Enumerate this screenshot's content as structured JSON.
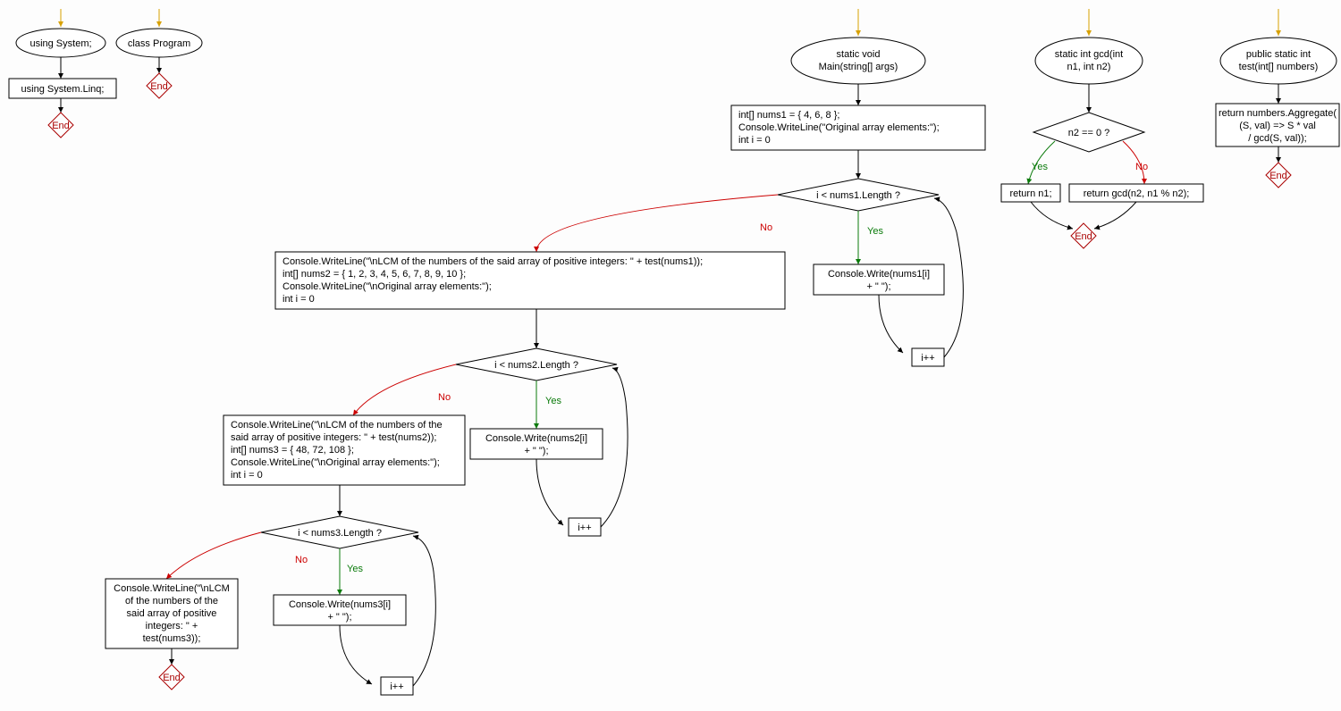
{
  "t_using_system": "using System;",
  "t_using_linq": "using System.Linq;",
  "t_class_program": "class Program",
  "t_end": "End",
  "t_main1": "static void",
  "t_main2": "Main(string[] args)",
  "t_main_block1_l1": "int[] nums1 = { 4, 6, 8 };",
  "t_main_block1_l2": "Console.WriteLine(\"Original array elements:\");",
  "t_main_block1_l3": "int i = 0",
  "t_cond1": "i < nums1.Length ?",
  "t_write1_l1": "Console.Write(nums1[i]",
  "t_write1_l2": "+ \" \");",
  "t_inc": "i++",
  "t_block2_l1": "Console.WriteLine(\"\\nLCM of the numbers of the said array of positive integers: \" + test(nums1));",
  "t_block2_l2": "int[] nums2 = { 1, 2, 3, 4, 5, 6, 7, 8, 9, 10 };",
  "t_block2_l3": "Console.WriteLine(\"\\nOriginal array elements:\");",
  "t_block2_l4": "int i = 0",
  "t_cond2": "i < nums2.Length ?",
  "t_write2_l1": "Console.Write(nums2[i]",
  "t_write2_l2": "+ \" \");",
  "t_block3_l1": "Console.WriteLine(\"\\nLCM of the numbers of the",
  "t_block3_l2": "said array of positive integers: \" + test(nums2));",
  "t_block3_l3": "int[] nums3 = { 48, 72, 108 };",
  "t_block3_l4": "Console.WriteLine(\"\\nOriginal array elements:\");",
  "t_block3_l5": "int i = 0",
  "t_cond3": "i < nums3.Length ?",
  "t_write3_l1": "Console.Write(nums3[i]",
  "t_write3_l2": "+ \" \");",
  "t_block4_l1": "Console.WriteLine(\"\\nLCM",
  "t_block4_l2": "of the numbers of the",
  "t_block4_l3": "said array of positive",
  "t_block4_l4": "integers: \" +",
  "t_block4_l5": "test(nums3));",
  "t_gcd1": "static int gcd(int",
  "t_gcd2": "n1, int n2)",
  "t_gcd_cond": "n2 == 0 ?",
  "t_gcd_yes": "return n1;",
  "t_gcd_no": "return gcd(n2, n1 % n2);",
  "t_test1": "public static int",
  "t_test2": "test(int[] numbers)",
  "t_test_body1": "return numbers.Aggregate(",
  "t_test_body2": "(S, val) => S * val",
  "t_test_body3": "/ gcd(S, val));",
  "t_yes": "Yes",
  "t_no": "No"
}
